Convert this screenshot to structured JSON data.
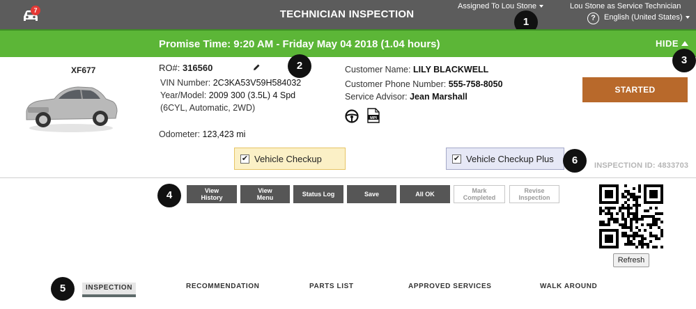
{
  "header": {
    "notification_count": "7",
    "title": "TECHNICIAN INSPECTION",
    "assigned_to": "Assigned To Lou Stone",
    "user_role": "Lou Stone as Service Technician",
    "language": "English (United States)",
    "help_icon": "?"
  },
  "callouts": [
    "1",
    "2",
    "3",
    "4",
    "5",
    "6"
  ],
  "promise": {
    "text": "Promise Time: 9:20 AM - Friday May 04 2018 (1.04 hours)",
    "hide_label": "HIDE"
  },
  "vehicle": {
    "id": "XF677",
    "ro_label": "RO#:",
    "ro_value": "316560",
    "vin_label": "VIN Number:",
    "vin_value": "2C3KA53V59H584032",
    "year_model_label": "Year/Model:",
    "year_model_value": "2009 300 (3.5L) 4 Spd",
    "year_model_value_2": "(6CYL, Automatic, 2WD)",
    "odometer_label": "Odometer:",
    "odometer_value": "123,423 mi"
  },
  "customer": {
    "name_label": "Customer Name:",
    "name_value": "LILY BLACKWELL",
    "phone_label": "Customer Phone Number:",
    "phone_value": "555-758-8050",
    "advisor_label": "Service Advisor:",
    "advisor_value": "Jean Marshall",
    "mpi_label": "MPI"
  },
  "status_button": "STARTED",
  "checkups": {
    "vehicle_checkup": "Vehicle Checkup",
    "vehicle_checkup_plus": "Vehicle Checkup Plus",
    "check_mark": "✔"
  },
  "inspection_id": "INSPECTION ID: 4833703",
  "actions": {
    "view_history_1": "View",
    "view_history_2": "History",
    "view_menu_1": "View",
    "view_menu_2": "Menu",
    "status_log": "Status Log",
    "save": "Save",
    "all_ok": "All OK",
    "mark_completed_1": "Mark",
    "mark_completed_2": "Completed",
    "revise_inspection_1": "Revise",
    "revise_inspection_2": "Inspection"
  },
  "refresh_label": "Refresh",
  "tabs": {
    "inspection": "INSPECTION",
    "recommendation": "RECOMMENDATION",
    "parts_list": "PARTS LIST",
    "approved_services": "APPROVED SERVICES",
    "walk_around": "WALK AROUND"
  },
  "colors": {
    "header_bg": "#5c5c5c",
    "promise_bg": "#5cb637",
    "started_bg": "#b8692b",
    "action_bg": "#565656",
    "notification_badge": "#e53935"
  }
}
